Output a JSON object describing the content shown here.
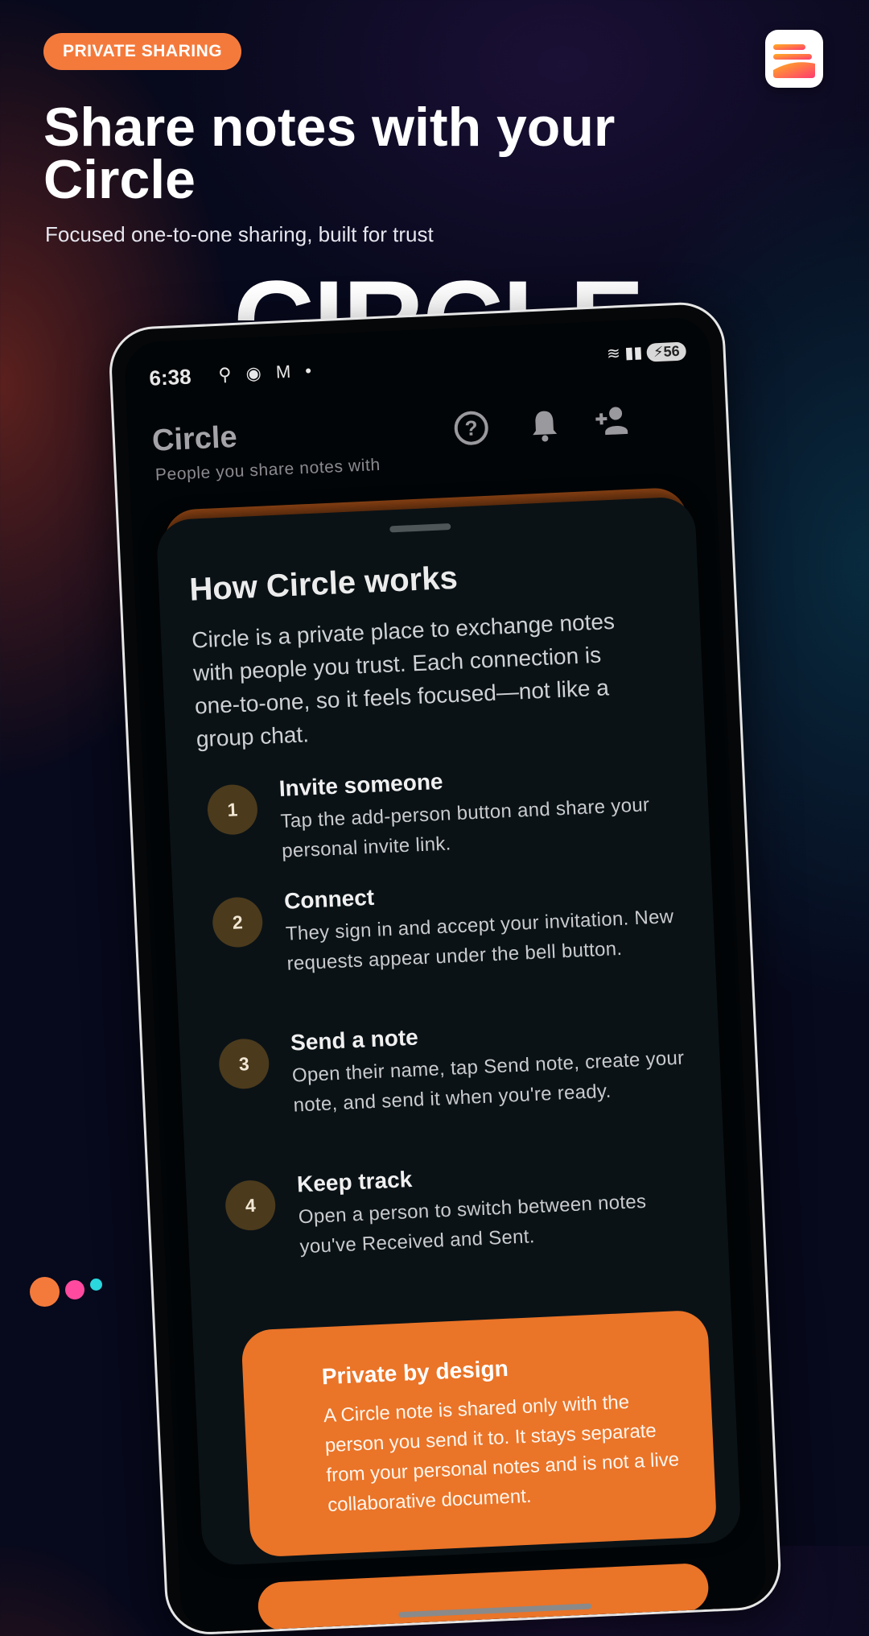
{
  "badge": "PRIVATE SHARING",
  "headline": "Share notes with your Circle",
  "subheadline": "Focused one-to-one sharing, built for trust",
  "background_word": "CIRCLE",
  "colors": {
    "accent": "#f47a3c",
    "card": "#ea7428",
    "step_circle": "#4b3a1c",
    "background": "#07091c"
  },
  "status_bar": {
    "time": "6:38",
    "battery": "56"
  },
  "app_bar": {
    "title": "Circle",
    "subtitle": "People you share notes with",
    "icons": [
      "help-icon",
      "bell-icon",
      "add-person-icon"
    ]
  },
  "sheet": {
    "title": "How Circle works",
    "intro": "Circle is a private place to exchange notes with people you trust. Each connection is one-to-one, so it feels focused—not like a group chat.",
    "steps": [
      {
        "num": "1",
        "title": "Invite someone",
        "body": "Tap the add-person button and share your personal invite link."
      },
      {
        "num": "2",
        "title": "Connect",
        "body": "They sign in and accept your invitation. New requests appear under the bell button."
      },
      {
        "num": "3",
        "title": "Send a note",
        "body": "Open their name, tap Send note, create your note, and send it when you're ready."
      },
      {
        "num": "4",
        "title": "Keep track",
        "body": "Open a person to switch between notes you've Received and Sent."
      }
    ],
    "privacy_card": {
      "title": "Private by design",
      "body": "A Circle note is shared only with the person you send it to. It stays separate from your personal notes and is not a live collaborative document."
    }
  }
}
